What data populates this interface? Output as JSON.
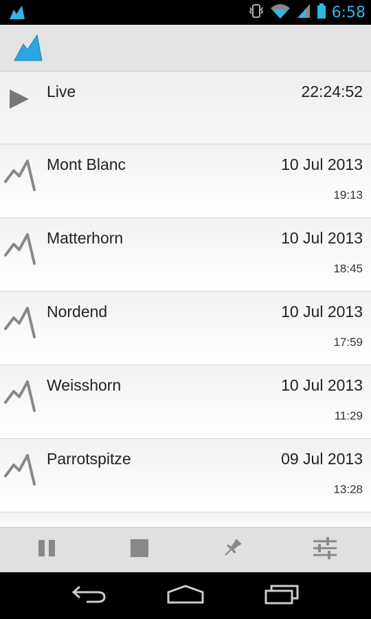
{
  "status_bar": {
    "time": "6:58",
    "icons": [
      "app-mountain-icon",
      "vibrate-icon",
      "wifi-icon",
      "signal-icon",
      "battery-icon"
    ]
  },
  "action_bar": {
    "logo": "mountain-logo-icon"
  },
  "list": {
    "live": {
      "label": "Live",
      "time": "22:24:52",
      "icon": "play-icon"
    },
    "items": [
      {
        "name": "Mont Blanc",
        "date": "10 Jul 2013",
        "time": "19:13",
        "icon": "peak-icon"
      },
      {
        "name": "Matterhorn",
        "date": "10 Jul 2013",
        "time": "18:45",
        "icon": "peak-icon"
      },
      {
        "name": "Nordend",
        "date": "10 Jul 2013",
        "time": "17:59",
        "icon": "peak-icon"
      },
      {
        "name": "Weisshorn",
        "date": "10 Jul 2013",
        "time": "11:29",
        "icon": "peak-icon"
      },
      {
        "name": "Parrotspitze",
        "date": "09 Jul 2013",
        "time": "13:28",
        "icon": "peak-icon"
      }
    ]
  },
  "toolbar": {
    "buttons": [
      "pause-icon",
      "stop-icon",
      "pin-icon",
      "settings-sliders-icon"
    ]
  },
  "nav_bar": {
    "buttons": [
      "back-icon",
      "home-icon",
      "recents-icon"
    ]
  },
  "colors": {
    "accent": "#33b5e5",
    "logo_blue": "#29a8e0"
  }
}
